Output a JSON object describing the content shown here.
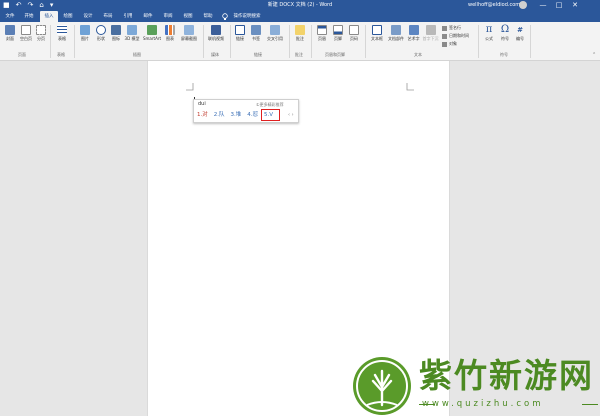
{
  "window": {
    "title": "新建 DOCX 文档 (2) - Word",
    "user": "wellhoff@eldiod.com",
    "qat": [
      "■",
      "↶",
      "↷",
      "⌂",
      "▾"
    ],
    "controls": [
      "—",
      "□",
      "✕"
    ]
  },
  "tabs": [
    {
      "label": "文件",
      "active": false
    },
    {
      "label": "开始",
      "active": false
    },
    {
      "label": "插入",
      "active": true
    },
    {
      "label": "绘图",
      "active": false
    },
    {
      "label": "设计",
      "active": false
    },
    {
      "label": "布局",
      "active": false
    },
    {
      "label": "引用",
      "active": false
    },
    {
      "label": "邮件",
      "active": false
    },
    {
      "label": "审阅",
      "active": false
    },
    {
      "label": "视图",
      "active": false
    },
    {
      "label": "帮助",
      "active": false
    },
    {
      "label": "操作说明搜索",
      "active": false
    }
  ],
  "ribbon": {
    "buttons": [
      "封面",
      "空白页",
      "分页",
      "表格",
      "图片",
      "形状",
      "图标",
      "3D 模型",
      "SmartArt",
      "图表",
      "屏幕截图",
      "联机视频",
      "链接",
      "书签",
      "交叉引用",
      "批注",
      "页眉",
      "页脚",
      "页码",
      "文本框",
      "文档部件",
      "艺术字",
      "首字下沉",
      "公式",
      "符号",
      "编号"
    ],
    "small_items": [
      "签名行",
      "日期和时间",
      "对象"
    ],
    "groups": [
      "页面",
      "表格",
      "插图",
      "媒体",
      "链接",
      "批注",
      "页眉和页脚",
      "文本",
      "符号"
    ]
  },
  "ime": {
    "composition": "dui",
    "hint": "①更多精彩推荐",
    "candidates": [
      "1.对",
      "2.队",
      "3.堆",
      "4.怼",
      "5.V"
    ],
    "nav": "‹ ›"
  },
  "watermark": {
    "title": "紫竹新游网",
    "url": "www.quzizhu.com"
  },
  "colors": {
    "title_bar": "#2b579a",
    "ribbon": "#f3f3f3",
    "workspace": "#e6e6e6",
    "page": "#ffffff",
    "ime_highlight": "#e02020",
    "watermark_green": "#4c8a22"
  }
}
